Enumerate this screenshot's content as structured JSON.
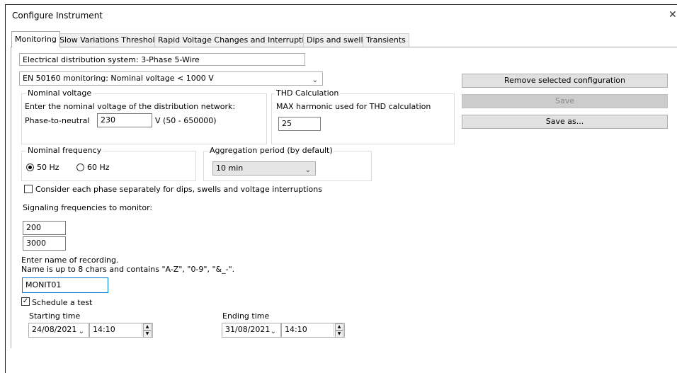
{
  "window": {
    "title": "Configure Instrument",
    "close_glyph": "✕"
  },
  "tabs": [
    "Monitoring",
    "Slow Variations Thresholds",
    "Rapid Voltage Changes and Interruptions",
    "Dips and swells",
    "Transients"
  ],
  "distribution_system": "Electrical distribution system: 3-Phase 5-Wire",
  "monitoring_standard": "EN 50160 monitoring: Nominal voltage < 1000 V",
  "buttons": {
    "remove": "Remove selected configuration",
    "save": "Save",
    "save_as": "Save as..."
  },
  "nominal_voltage": {
    "legend": "Nominal voltage",
    "instruction": "Enter the nominal voltage of the distribution network:",
    "label": "Phase-to-neutral",
    "value": "230",
    "range": "V (50 - 650000)"
  },
  "thd": {
    "legend": "THD Calculation",
    "label": "MAX harmonic used for THD calculation",
    "value": "25"
  },
  "frequency": {
    "legend": "Nominal frequency",
    "options": [
      "50 Hz",
      "60 Hz"
    ],
    "selected": "50 Hz"
  },
  "aggregation": {
    "legend": "Aggregation period (by default)",
    "value": "10 min"
  },
  "separate_phase": {
    "label": "Consider each phase separately for dips, swells and voltage interruptions",
    "checked": false
  },
  "signaling": {
    "label": "Signaling frequencies to monitor:",
    "values": [
      "200",
      "3000"
    ]
  },
  "recording": {
    "instruction_1": "Enter name of recording.",
    "instruction_2": "Name is up to 8 chars and contains \"A-Z\", \"0-9\", \"&_-\".",
    "name": "MONIT01"
  },
  "schedule": {
    "label": "Schedule a test",
    "checked": true,
    "start_label": "Starting time",
    "start_date": "24/08/2021",
    "start_time": "14:10",
    "end_label": "Ending time",
    "end_date": "31/08/2021",
    "end_time": "14:10"
  },
  "icons": {
    "dropdown": "chevron-down-icon",
    "spin_up": "▲",
    "spin_down": "▼",
    "check": "✓"
  }
}
